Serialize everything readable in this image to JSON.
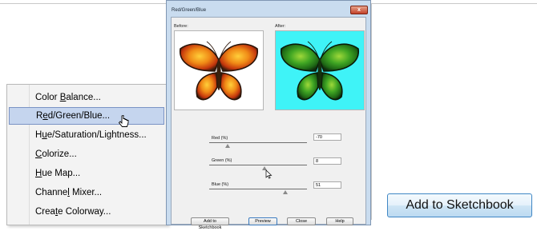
{
  "menu": {
    "items": [
      {
        "pre": "Color ",
        "ul": "B",
        "post": "alance..."
      },
      {
        "pre": "R",
        "ul": "e",
        "post": "d/Green/Blue..."
      },
      {
        "pre": "H",
        "ul": "u",
        "post": "e/Saturation/Lightness..."
      },
      {
        "pre": "",
        "ul": "C",
        "post": "olorize..."
      },
      {
        "pre": "",
        "ul": "H",
        "post": "ue Map..."
      },
      {
        "pre": "Channe",
        "ul": "l",
        "post": " Mixer..."
      },
      {
        "pre": "Crea",
        "ul": "t",
        "post": "e Colorway..."
      }
    ],
    "highlighted_index": 1
  },
  "dialog": {
    "title": "Red/Green/Blue",
    "before_label": "Before:",
    "after_label": "After:",
    "red_label": "Red (%)",
    "red_value": "-70",
    "green_label": "Green (%)",
    "green_value": "8",
    "blue_label": "Blue (%)",
    "blue_value": "51",
    "buttons": {
      "add": "Add to Sketchbook",
      "preview": "Preview",
      "close": "Close",
      "help": "Help"
    },
    "close_glyph": "x"
  },
  "big_button": {
    "label": "Add to Sketchbook"
  },
  "colors": {
    "dialog_frame": "#c9dcef",
    "after_background": "#3ff3f7",
    "highlight": "#c5d5ee",
    "button_border": "#3f86c4"
  }
}
